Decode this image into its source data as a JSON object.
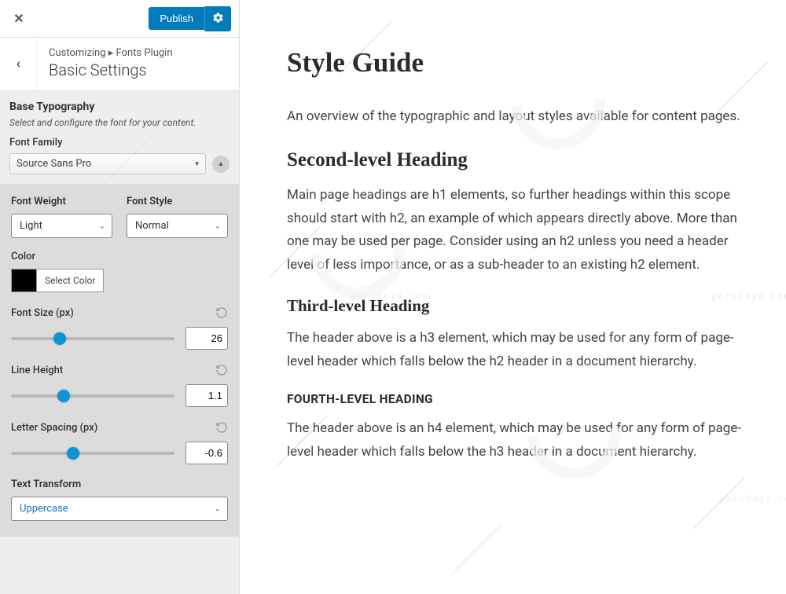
{
  "header": {
    "publish_label": "Publish"
  },
  "crumb": {
    "prefix": "Customizing ▸ Fonts Plugin",
    "title": "Basic Settings"
  },
  "base_typography": {
    "heading": "Base Typography",
    "description": "Select and configure the font for your content.",
    "font_family_label": "Font Family",
    "font_family_value": "Source Sans Pro"
  },
  "controls": {
    "font_weight_label": "Font Weight",
    "font_weight_value": "Light",
    "font_style_label": "Font Style",
    "font_style_value": "Normal",
    "color_label": "Color",
    "color_hex": "#000000",
    "select_color_label": "Select Color",
    "font_size_label": "Font Size (px)",
    "font_size_value": "26",
    "line_height_label": "Line Height",
    "line_height_value": "1.1",
    "letter_spacing_label": "Letter Spacing (px)",
    "letter_spacing_value": "-0.6",
    "text_transform_label": "Text Transform",
    "text_transform_value": "Uppercase"
  },
  "preview": {
    "h1": "Style Guide",
    "p1": "An overview of the typographic and layout styles available for content pages.",
    "h2": "Second-level Heading",
    "p2": "Main page headings are h1 elements, so further headings within this scope should start with h2, an example of which appears directly above. More than one may be used per page. Consider using an h2 unless you need a header level of less importance, or as a sub-header to an existing h2 element.",
    "h3": "Third-level Heading",
    "p3": "The header above is a h3 element, which may be used for any form of page-level header which falls below the h2 header in a document hierarchy.",
    "h4": "Fourth-level Heading",
    "p4": "The header above is an h4 element, which may be used for any form of page-level header which falls below the h3 header in a document hierarchy."
  },
  "watermark_text": "garudeya.com"
}
